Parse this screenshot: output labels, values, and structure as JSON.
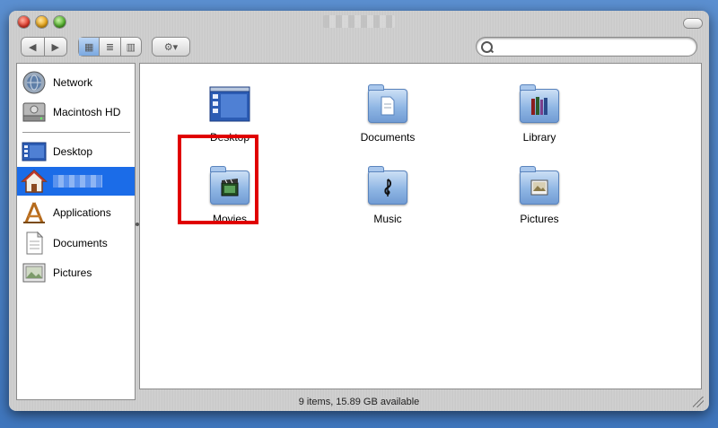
{
  "window": {
    "title": ""
  },
  "toolbar": {
    "back_glyph": "◀",
    "forward_glyph": "▶",
    "view_icon_glyph": "▦",
    "view_list_glyph": "≣",
    "view_column_glyph": "▥",
    "action_glyph": "⚙▾",
    "search_placeholder": ""
  },
  "sidebar": {
    "devices": [
      {
        "label": "Network",
        "icon": "network-globe-icon"
      },
      {
        "label": "Macintosh HD",
        "icon": "hard-drive-icon"
      }
    ],
    "places": [
      {
        "label": "Desktop",
        "icon": "desktop-icon"
      },
      {
        "label": "",
        "icon": "home-icon",
        "selected": true
      },
      {
        "label": "Applications",
        "icon": "applications-icon"
      },
      {
        "label": "Documents",
        "icon": "documents-icon"
      },
      {
        "label": "Pictures",
        "icon": "pictures-icon"
      }
    ]
  },
  "main": {
    "items": [
      {
        "label": "Desktop",
        "icon": "desktop-folder-icon"
      },
      {
        "label": "Documents",
        "icon": "documents-folder-icon"
      },
      {
        "label": "Library",
        "icon": "library-folder-icon"
      },
      {
        "label": "Movies",
        "icon": "movies-folder-icon"
      },
      {
        "label": "Music",
        "icon": "music-folder-icon"
      },
      {
        "label": "Pictures",
        "icon": "pictures-folder-icon"
      }
    ]
  },
  "status": {
    "text": "9 items, 15.89 GB available"
  },
  "colors": {
    "selection": "#1b6ce8",
    "highlight": "#e00000",
    "desktop_bg": "#4a7fc4"
  }
}
